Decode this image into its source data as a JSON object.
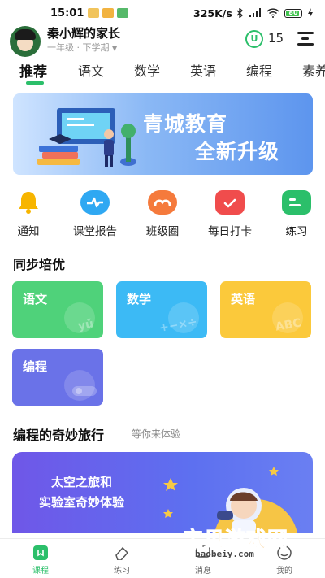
{
  "status_bar": {
    "time": "15:01",
    "speed": "325K/s",
    "battery": "80"
  },
  "header": {
    "username": "秦小辉的家长",
    "grade": "一年级 · 下学期",
    "coin_symbol": "U",
    "coin_count": "15"
  },
  "tabs": [
    {
      "label": "推荐",
      "active": true
    },
    {
      "label": "语文"
    },
    {
      "label": "数学"
    },
    {
      "label": "英语"
    },
    {
      "label": "编程"
    },
    {
      "label": "素养"
    }
  ],
  "banner": {
    "line1": "青城教育",
    "line2": "全新升级"
  },
  "shortcuts": [
    {
      "label": "通知",
      "icon": "bell-icon",
      "color": "#f7b500"
    },
    {
      "label": "课堂报告",
      "icon": "report-icon",
      "color": "#2fa8f2"
    },
    {
      "label": "班级圈",
      "icon": "class-circle-icon",
      "color": "#f57a3c"
    },
    {
      "label": "每日打卡",
      "icon": "calendar-check-icon",
      "color": "#f04c4c"
    },
    {
      "label": "练习",
      "icon": "practice-icon",
      "color": "#2bbf6a"
    }
  ],
  "sync_section": {
    "title": "同步培优",
    "subjects": [
      {
        "label": "语文",
        "watermark": "yǔ",
        "color": "#4fd27a"
      },
      {
        "label": "数学",
        "watermark": "+−×÷",
        "color": "#3cbaf5"
      },
      {
        "label": "英语",
        "watermark": "ABC",
        "color": "#fbc93b"
      },
      {
        "label": "编程",
        "watermark": "",
        "color": "#6a72e8"
      }
    ]
  },
  "coding_section": {
    "title": "编程的奇妙旅行",
    "subtitle": "等你来体验",
    "promo_line1": "太空之旅和",
    "promo_line2": "实验室奇妙体验"
  },
  "bottom_nav": [
    {
      "label": "课程",
      "icon": "course-icon",
      "active": true
    },
    {
      "label": "练习",
      "icon": "eraser-icon"
    },
    {
      "label": "消息",
      "icon": "message-icon"
    },
    {
      "label": "我的",
      "icon": "profile-icon"
    }
  ],
  "watermark": {
    "title": "宝贝游戏网",
    "url": "baobeiy.com"
  },
  "colors": {
    "accent": "#2bbf6a"
  }
}
